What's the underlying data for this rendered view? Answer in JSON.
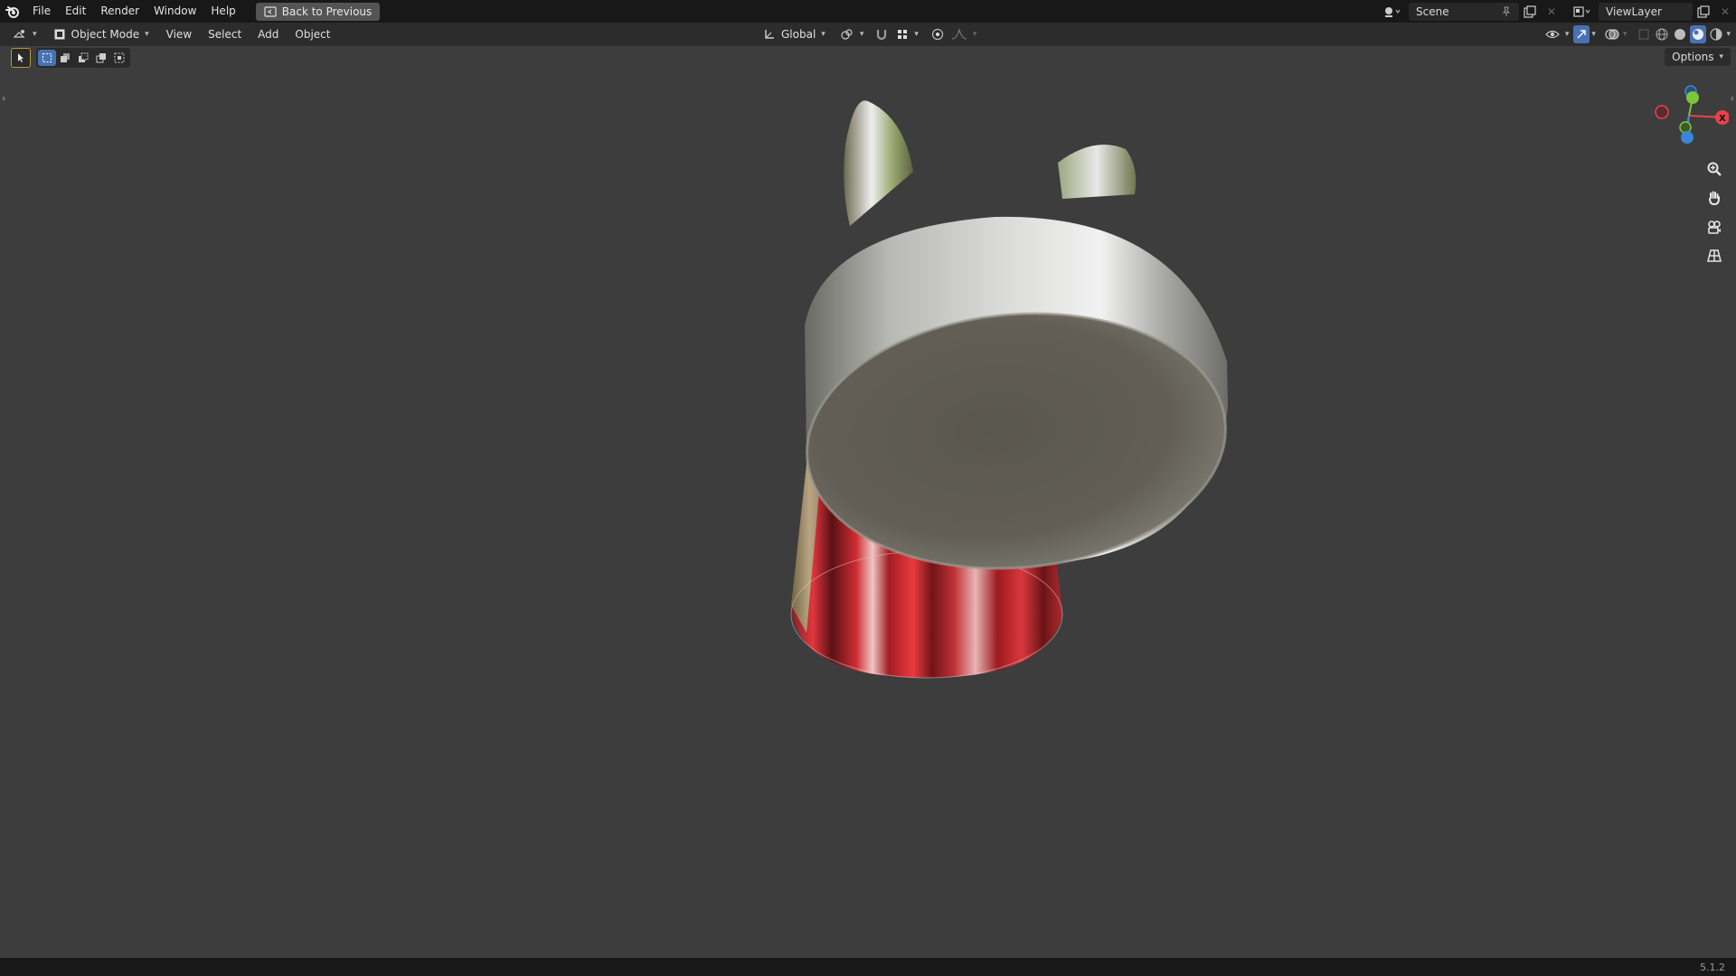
{
  "topbar": {
    "menu": [
      "File",
      "Edit",
      "Render",
      "Window",
      "Help"
    ],
    "back_button": "Back to Previous",
    "scene_name": "Scene",
    "view_layer_name": "ViewLayer"
  },
  "header": {
    "mode": "Object Mode",
    "menu": [
      "View",
      "Select",
      "Add",
      "Object"
    ],
    "transform_orientation": "Global"
  },
  "toolbar": {
    "options_label": "Options"
  },
  "gizmo": {
    "x_label": "X",
    "colors": {
      "x": "#e8414b",
      "y": "#7ec53a",
      "z": "#3a86d8"
    }
  },
  "status": {
    "version": "5.1.2"
  },
  "colors": {
    "viewport_bg": "#3d3d3d",
    "topbar_bg": "#181818",
    "header_bg": "#2c2c2c",
    "accent_blue": "#4772b3"
  }
}
